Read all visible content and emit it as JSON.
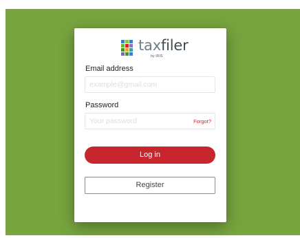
{
  "brand": {
    "word_light": "tax",
    "word_dark": "filer",
    "byline": "by IRIS"
  },
  "form": {
    "email_label": "Email address",
    "email_placeholder": "example@gmail.com",
    "password_label": "Password",
    "password_placeholder": "Your password",
    "forgot_label": "Forgot?",
    "login_label": "Log in",
    "register_label": "Register"
  },
  "colors": {
    "background": "#78a53e",
    "accent": "#c8262f"
  }
}
